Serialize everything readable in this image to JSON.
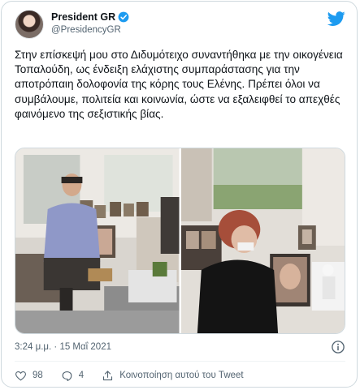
{
  "author": {
    "display_name": "President GR",
    "handle": "@PresidencyGR",
    "avatar_icon": "avatar-photo",
    "verified_icon": "verified-badge-icon"
  },
  "brand": {
    "logo_icon": "twitter-bird-icon",
    "accent": "#1d9bf0"
  },
  "tweet": {
    "text": "Στην επίσκεψή μου στο Διδυμότειχο συναντήθηκα με την οικογένεια Τοπαλούδη, ως ένδειξη ελάχιστης συμπαράστασης για την αποτρόπαιη δολοφονία της κόρης τους Ελένης. Πρέπει όλοι να συμβάλουμε, πολιτεία και κοινωνία, ώστε να εξαλειφθεί το απεχθές φαινόμενο της σεξιστικής βίας.",
    "timestamp": "3:24 μ.μ. · 15 Μαΐ 2021"
  },
  "media": {
    "photos": [
      {
        "icon": "photo-left"
      },
      {
        "icon": "photo-right"
      }
    ]
  },
  "actions": {
    "like_count": "98",
    "reply_count": "4",
    "share_label": "Κοινοποίηση αυτού του Tweet"
  },
  "colors": {
    "text_primary": "#0f1419",
    "text_secondary": "#536471",
    "border": "#cfd9de",
    "like": "#536471"
  }
}
